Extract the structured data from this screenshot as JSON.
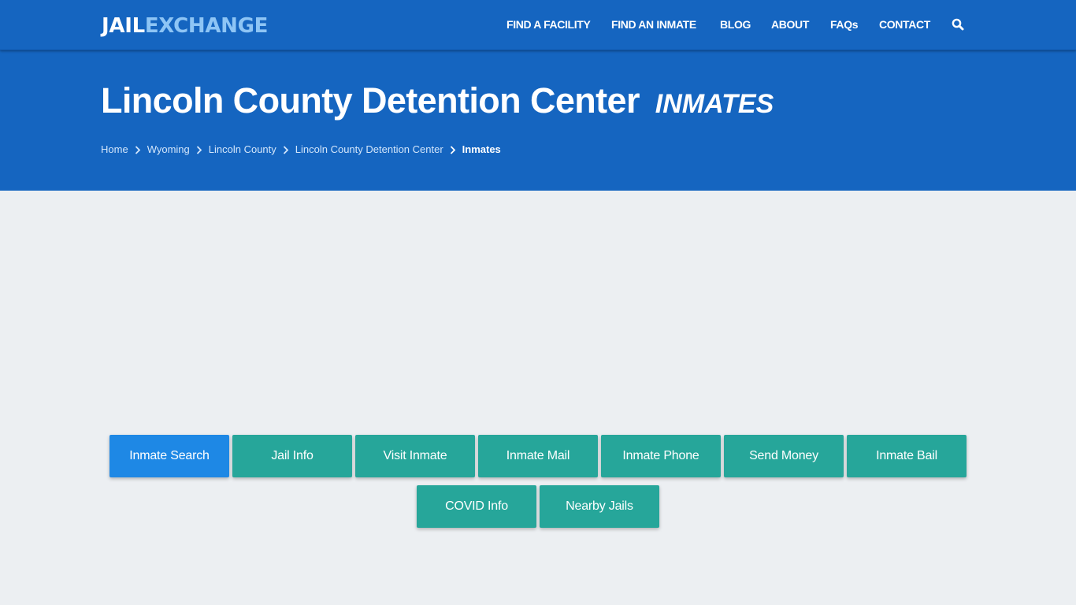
{
  "brand": {
    "logo_part1": "JAIL",
    "logo_part2": "EXCHANGE",
    "primary_color": "#1565c0",
    "accent_color": "#8ec5f5"
  },
  "nav": {
    "items": [
      {
        "label": "FIND A FACILITY"
      },
      {
        "label": "FIND AN INMATE"
      },
      {
        "label": "BLOG"
      },
      {
        "label": "ABOUT"
      },
      {
        "label": "FAQs"
      },
      {
        "label": "CONTACT"
      }
    ],
    "search_icon": "search-icon"
  },
  "hero": {
    "title": "Lincoln County Detention Center",
    "subtitle": "INMATES",
    "breadcrumb": [
      {
        "label": "Home"
      },
      {
        "label": "Wyoming"
      },
      {
        "label": "Lincoln County"
      },
      {
        "label": "Lincoln County Detention Center"
      },
      {
        "label": "Inmates"
      }
    ],
    "breadcrumb_separator_icon": "chevron-right-icon"
  },
  "actions": {
    "row1": [
      {
        "label": "Inmate Search",
        "active": true
      },
      {
        "label": "Jail Info"
      },
      {
        "label": "Visit Inmate"
      },
      {
        "label": "Inmate Mail"
      },
      {
        "label": "Inmate Phone"
      },
      {
        "label": "Send Money"
      },
      {
        "label": "Inmate Bail"
      }
    ],
    "row2": [
      {
        "label": "COVID Info"
      },
      {
        "label": "Nearby Jails"
      }
    ],
    "colors": {
      "active": "#1e88e5",
      "default": "#26a69a"
    }
  }
}
